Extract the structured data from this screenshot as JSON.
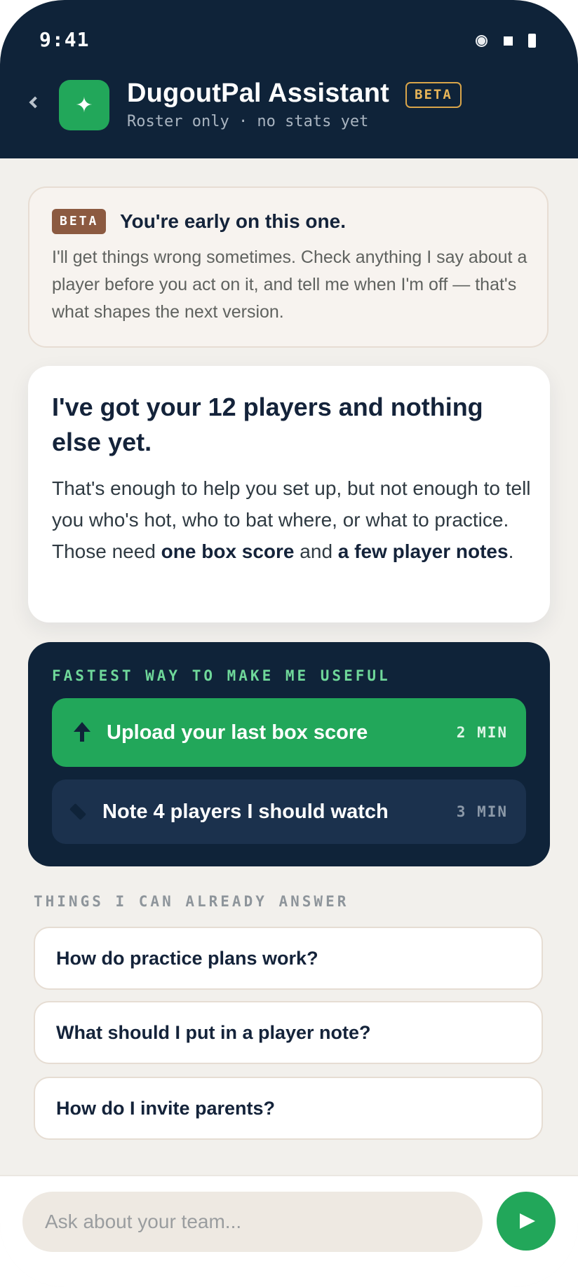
{
  "status_bar": {
    "time": "9:41"
  },
  "header": {
    "title": "DugoutPal Assistant",
    "badge": "BETA",
    "subtitle": "Roster only · no stats yet",
    "icon": "sparkle-icon"
  },
  "notice": {
    "badge": "BETA",
    "title": "You're early on this one.",
    "body": "I'll get things wrong sometimes. Check anything I say about a player before you act on it, and tell me when I'm off — that's what shapes the next version."
  },
  "summary": {
    "title": "I've got your 12 players and nothing else yet.",
    "body_intro": "That's enough to help you set up, but not enough to tell you who's hot, who to bat where, or what to practice. Those need ",
    "body_bold_1": "one box score",
    "body_mid": " and ",
    "body_bold_2": "a few player notes",
    "body_end": "."
  },
  "fastest": {
    "heading": "FASTEST WAY TO MAKE ME USEFUL",
    "actions": [
      {
        "label": "Upload your last box score",
        "time": "2 MIN",
        "icon": "upload-arrow-icon"
      },
      {
        "label": "Note 4 players I should watch",
        "time": "3 MIN",
        "icon": "pencil-icon"
      }
    ]
  },
  "answers": {
    "heading": "THINGS I CAN ALREADY ANSWER",
    "questions": [
      "How do practice plans work?",
      "What should I put in a player note?",
      "How do I invite parents?"
    ]
  },
  "composer": {
    "placeholder": "Ask about your team..."
  },
  "colors": {
    "navy": "#0f2339",
    "green": "#22a75a",
    "beta_gold": "#e8b558",
    "beta_brown": "#8c5a41",
    "background": "#f2f0ec"
  }
}
